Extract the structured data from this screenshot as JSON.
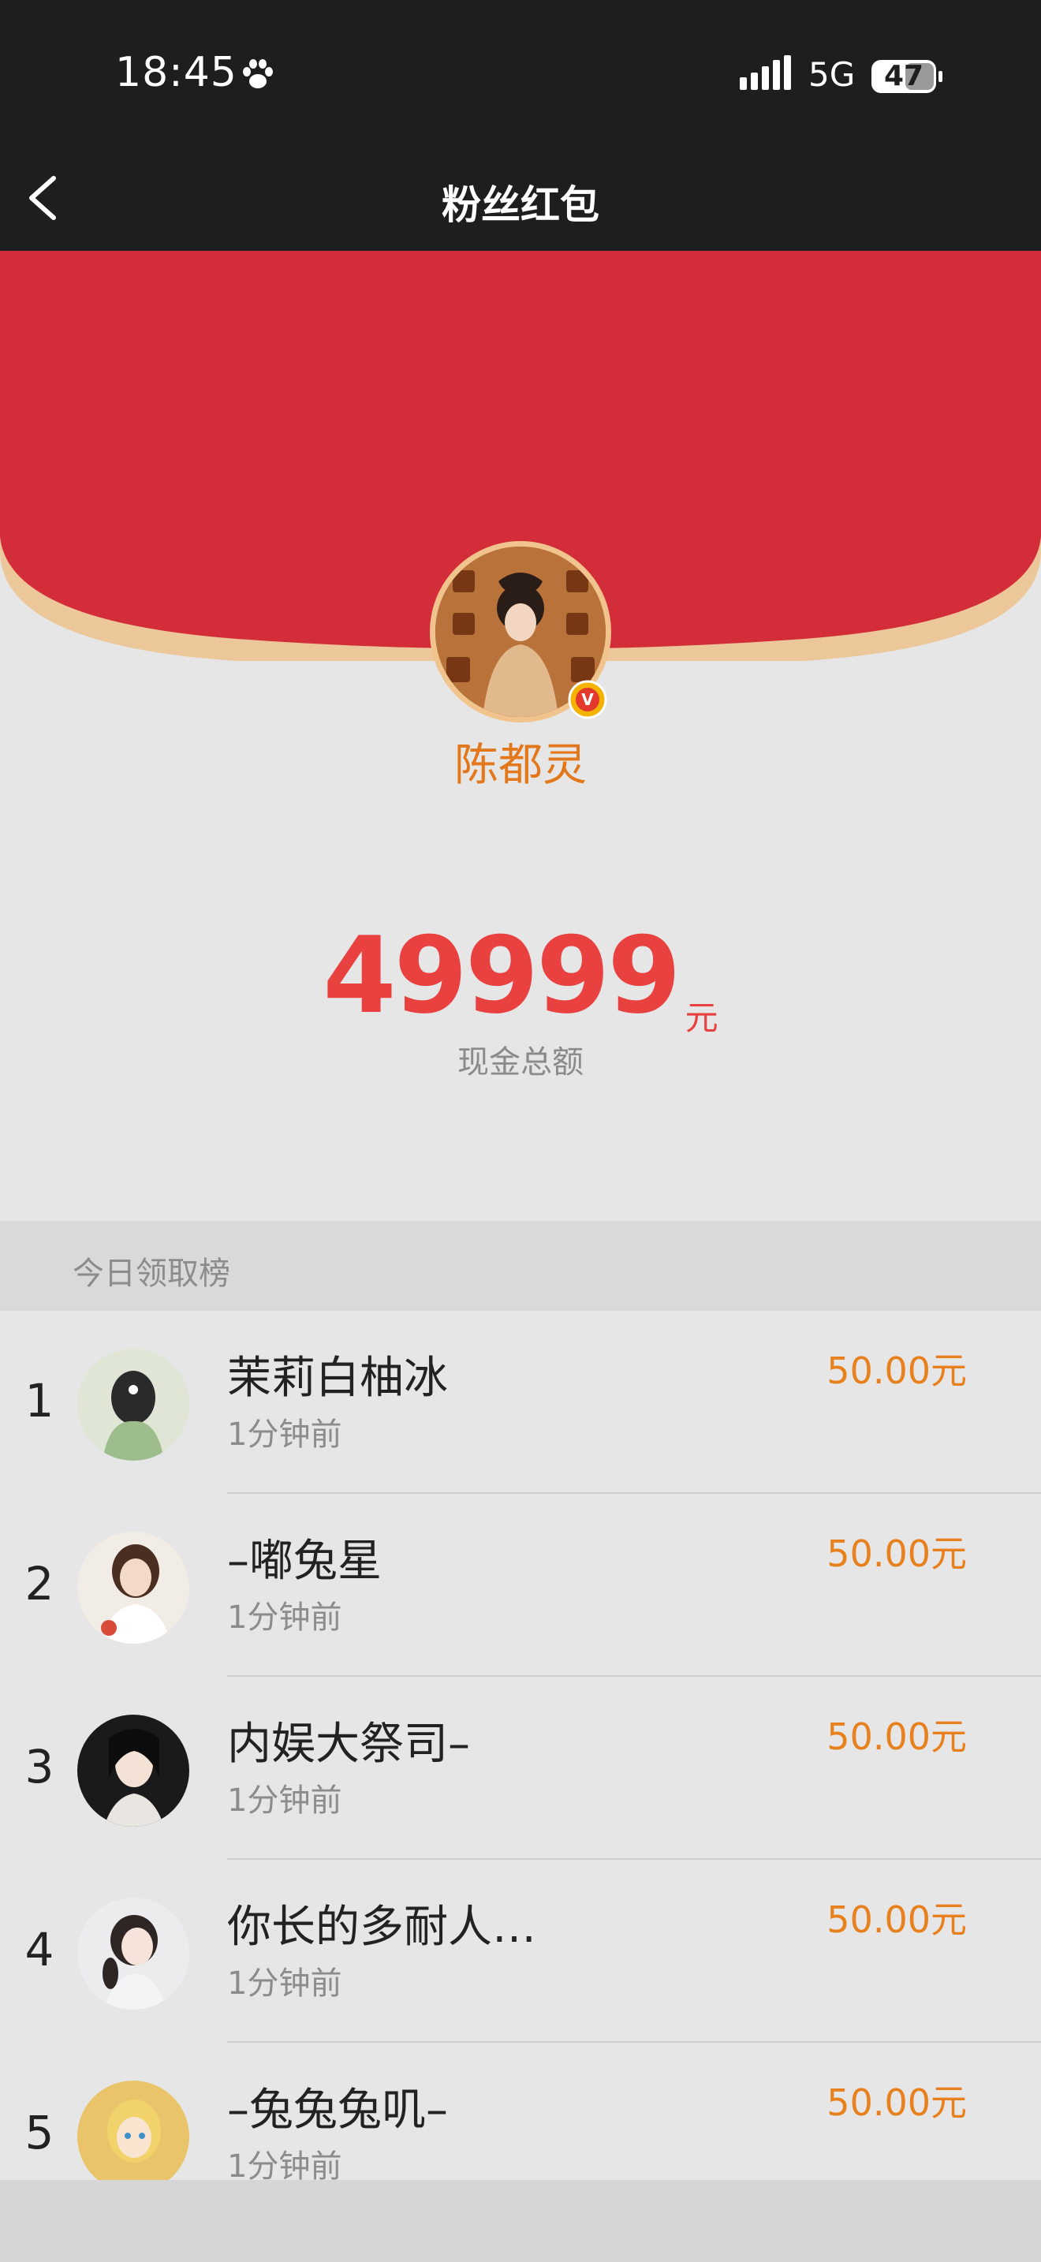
{
  "status_bar": {
    "time": "18:45",
    "network": "5G",
    "battery": "47"
  },
  "nav": {
    "title": "粉丝红包"
  },
  "host": {
    "name": "陈都灵",
    "verified": "V"
  },
  "amount": {
    "value": "49999",
    "unit": "元",
    "label": "现金总额"
  },
  "leaderboard": {
    "title": "今日领取榜",
    "rows": [
      {
        "rank": "1",
        "name": "茉莉白柚冰",
        "time": "1分钟前",
        "amount": "50.00元"
      },
      {
        "rank": "2",
        "name": "–嘟兔星",
        "time": "1分钟前",
        "amount": "50.00元"
      },
      {
        "rank": "3",
        "name": "内娱大祭司–",
        "time": "1分钟前",
        "amount": "50.00元"
      },
      {
        "rank": "4",
        "name": "你长的多耐人…",
        "time": "1分钟前",
        "amount": "50.00元"
      },
      {
        "rank": "5",
        "name": "–兔兔兔叽–",
        "time": "1分钟前",
        "amount": "50.00元"
      }
    ]
  },
  "colors": {
    "envelope_red": "#d42d3a",
    "envelope_trim": "#ecc79a",
    "accent_orange": "#e8801e",
    "amount_red": "#e8413f"
  }
}
